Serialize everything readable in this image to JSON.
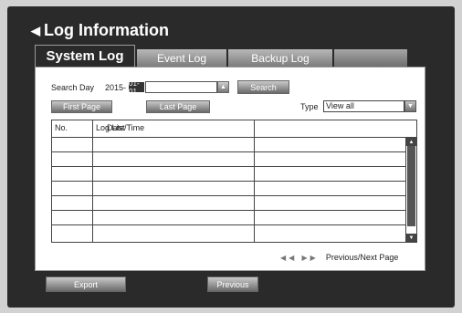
{
  "header": {
    "title": "Log Information",
    "icon": "chevron-left-icon"
  },
  "tabs": [
    {
      "label": "System Log",
      "active": true
    },
    {
      "label": "Event Log",
      "active": false
    },
    {
      "label": "Backup Log",
      "active": false
    },
    {
      "label": "",
      "active": false
    }
  ],
  "search": {
    "label": "Search Day",
    "year": "2015-",
    "month_day": "01-01",
    "date_value": "",
    "spin_icon": "spinner-icon",
    "button_label": "Search"
  },
  "paging": {
    "first_label": "First Page",
    "last_label": "Last Page"
  },
  "filter": {
    "type_label": "Type",
    "type_value": "View all",
    "dropdown_icon": "chevron-down-icon"
  },
  "table": {
    "columns": [
      "No.",
      "Log List",
      "Date/Time"
    ],
    "rows": [
      "",
      "",
      "",
      "",
      "",
      "",
      ""
    ]
  },
  "pager": {
    "icon": "prev-next-icon",
    "label": "Previous/Next Page"
  },
  "footer": {
    "export_label": "Export",
    "previous_label": "Previous"
  },
  "colors": {
    "frame": "#2a2a2a",
    "panel": "#ffffff",
    "button": "#8a8a8a"
  }
}
